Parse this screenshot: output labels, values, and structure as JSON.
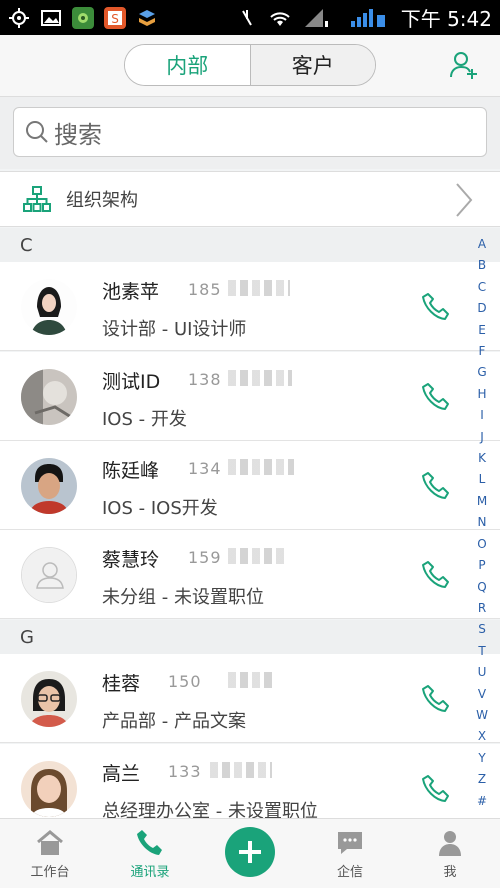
{
  "status_bar": {
    "time": "下午 5:42",
    "left_icons": [
      "location-icon",
      "image-icon",
      "flower-app-icon",
      "s-app-icon",
      "stack-app-icon"
    ],
    "right_icons": [
      "mute-icon",
      "wifi-icon",
      "signal1-icon",
      "signal2-icon"
    ]
  },
  "header": {
    "tabs": [
      {
        "label": "内部",
        "active": true
      },
      {
        "label": "客户",
        "active": false
      }
    ],
    "add_contact_icon": "add-user-icon"
  },
  "search": {
    "placeholder": "搜索"
  },
  "org": {
    "label": "组织架构"
  },
  "sections": [
    {
      "letter": "C"
    },
    {
      "letter": "G"
    }
  ],
  "contacts": [
    {
      "name": "池素苹",
      "phone": "185",
      "dept": "设计部 - UI设计师"
    },
    {
      "name": "测试ID",
      "phone": "138",
      "dept": "IOS - 开发"
    },
    {
      "name": "陈廷峰",
      "phone": "134",
      "dept": "IOS - IOS开发"
    },
    {
      "name": "蔡慧玲",
      "phone": "159",
      "dept": "未分组 - 未设置职位"
    },
    {
      "name": "桂蓉",
      "phone": "150",
      "dept": "产品部 - 产品文案"
    },
    {
      "name": "高兰",
      "phone": "133",
      "dept": "总经理办公室 - 未设置职位"
    }
  ],
  "alphabet": [
    "A",
    "B",
    "C",
    "D",
    "E",
    "F",
    "G",
    "H",
    "I",
    "J",
    "K",
    "L",
    "M",
    "N",
    "O",
    "P",
    "Q",
    "R",
    "S",
    "T",
    "U",
    "V",
    "W",
    "X",
    "Y",
    "Z",
    "#"
  ],
  "tabbar": {
    "items": [
      {
        "label": "工作台",
        "icon": "home-icon"
      },
      {
        "label": "通讯录",
        "icon": "phone-icon",
        "active": true
      },
      {
        "label": "",
        "icon": "plus-icon"
      },
      {
        "label": "企信",
        "icon": "chat-icon"
      },
      {
        "label": "我",
        "icon": "person-icon"
      }
    ]
  },
  "colors": {
    "accent": "#1aa37a",
    "alphabet": "#2b5fa8"
  }
}
